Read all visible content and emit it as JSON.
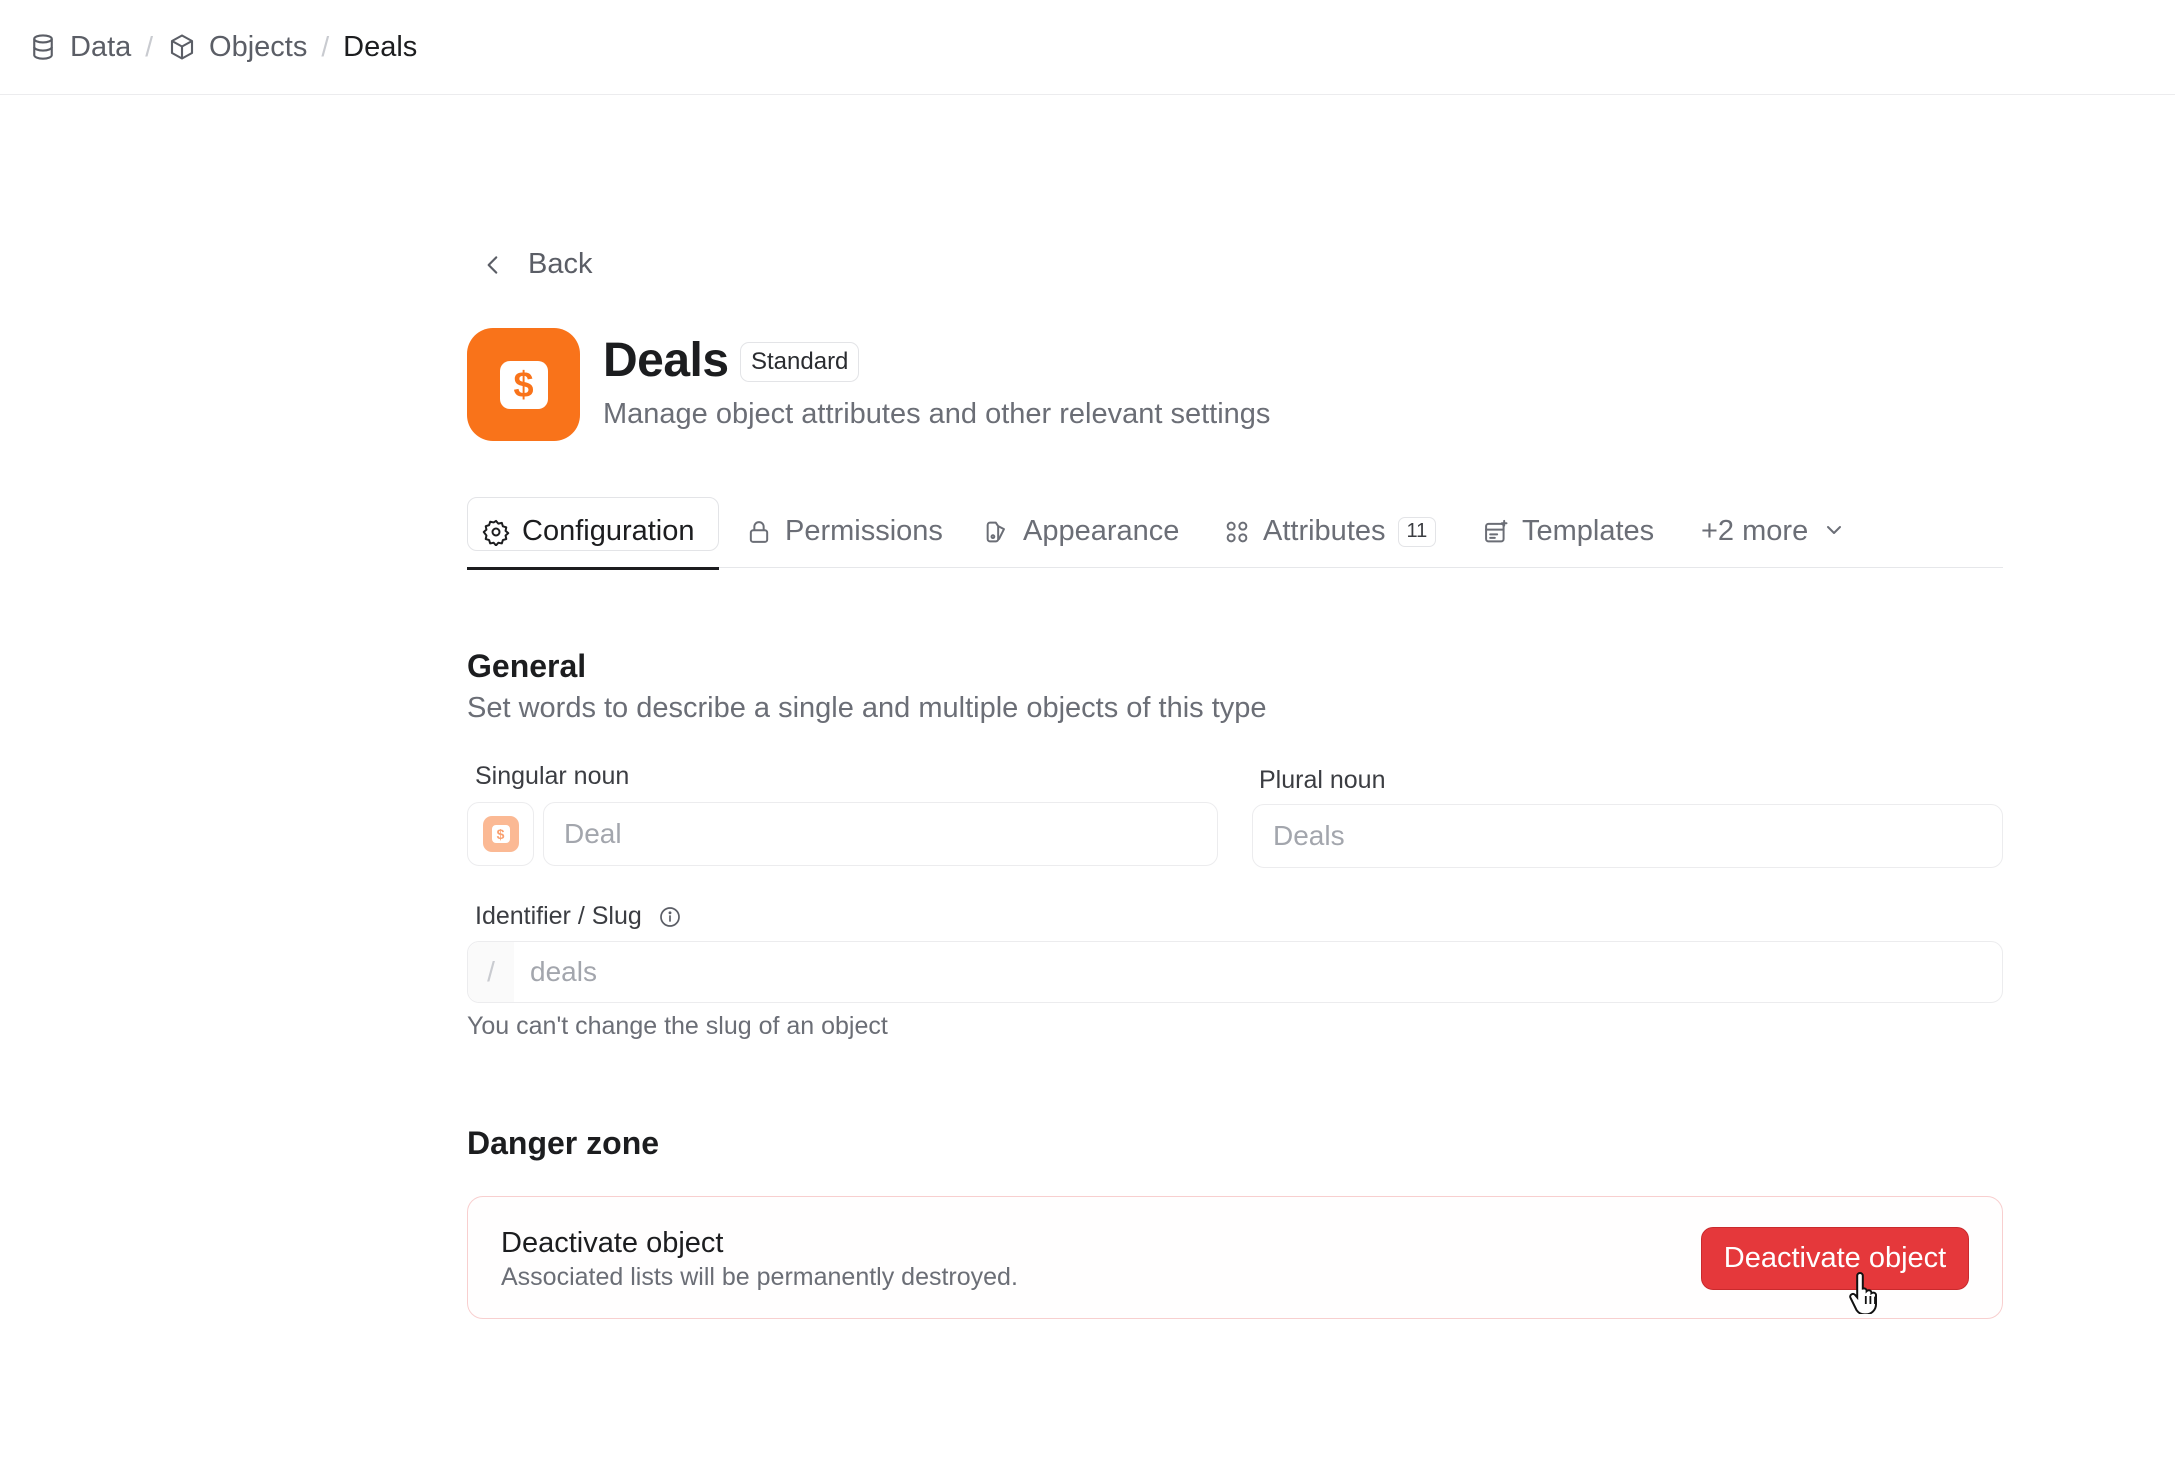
{
  "breadcrumb": [
    {
      "label": "Data",
      "icon": "database-icon"
    },
    {
      "label": "Objects",
      "icon": "cube-icon"
    },
    {
      "label": "Deals"
    }
  ],
  "back_label": "Back",
  "object": {
    "title": "Deals",
    "badge": "Standard",
    "subtitle": "Manage object attributes and other relevant settings",
    "icon_color": "#f9731a",
    "icon_glyph": "$"
  },
  "tabs": [
    {
      "label": "Configuration",
      "icon": "gear-icon",
      "active": true
    },
    {
      "label": "Permissions",
      "icon": "lock-icon"
    },
    {
      "label": "Appearance",
      "icon": "palette-icon"
    },
    {
      "label": "Attributes",
      "icon": "grid-icon",
      "count": "11"
    },
    {
      "label": "Templates",
      "icon": "template-icon"
    },
    {
      "label": "+2 more",
      "icon": "chevron-down-icon"
    }
  ],
  "general": {
    "title": "General",
    "description": "Set words to describe a single and multiple objects of this type",
    "singular_label": "Singular noun",
    "singular_value": "Deal",
    "plural_label": "Plural noun",
    "plural_value": "Deals",
    "slug_label": "Identifier / Slug",
    "slug_prefix": "/",
    "slug_value": "deals",
    "slug_hint": "You can't change the slug of an object"
  },
  "danger_zone": {
    "title": "Danger zone",
    "item_title": "Deactivate object",
    "item_description": "Associated lists will be permanently destroyed.",
    "button_label": "Deactivate object",
    "button_color": "#e5383b"
  }
}
